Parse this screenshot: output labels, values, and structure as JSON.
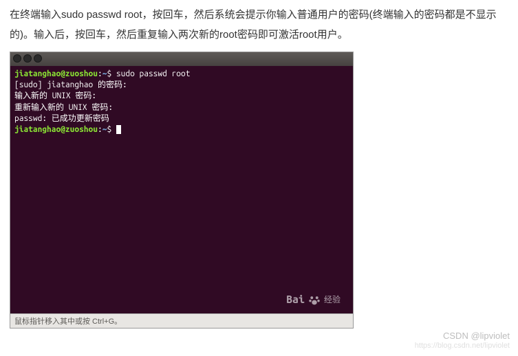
{
  "description": "在终端输入sudo passwd root，按回车，然后系统会提示你输入普通用户的密码(终端输入的密码都是不显示的)。输入后，按回车，然后重复输入两次新的root密码即可激活root用户。",
  "terminal": {
    "prompt_user": "jiatanghao@zuoshou",
    "prompt_path": "~",
    "prompt_symbol": "$",
    "command": "sudo passwd root",
    "lines": [
      "[sudo] jiatanghao 的密码:",
      "输入新的 UNIX 密码:",
      "重新输入新的 UNIX 密码:",
      "passwd: 已成功更新密码"
    ]
  },
  "watermark": {
    "brand_left": "Bai",
    "brand_right": "经验"
  },
  "statusline": "鼠标指针移入其中或按 Ctrl+G。",
  "footer_watermark": {
    "line1": "CSDN @lipviolet",
    "line2": "https://blog.csdn.net/lipviolet"
  }
}
